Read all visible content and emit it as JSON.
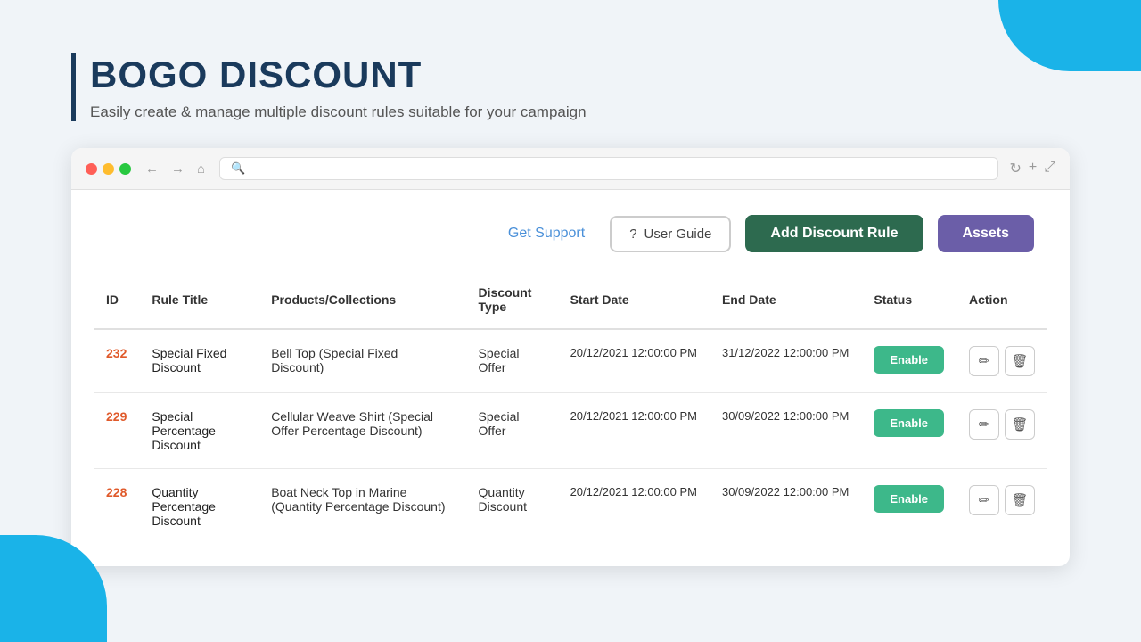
{
  "page": {
    "title": "BOGO DISCOUNT",
    "subtitle": "Easily create & manage multiple discount rules suitable for your campaign"
  },
  "toolbar": {
    "get_support_label": "Get Support",
    "user_guide_label": "User Guide",
    "add_discount_label": "Add Discount Rule",
    "assets_label": "Assets"
  },
  "table": {
    "headers": [
      "ID",
      "Rule Title",
      "Products/Collections",
      "Discount Type",
      "Start Date",
      "End Date",
      "Status",
      "Action"
    ],
    "rows": [
      {
        "id": "232",
        "rule_title": "Special Fixed Discount",
        "products": "Bell Top (Special Fixed Discount)",
        "discount_type": "Special Offer",
        "start_date": "20/12/2021 12:00:00 PM",
        "end_date": "31/12/2022 12:00:00 PM",
        "status": "Enable"
      },
      {
        "id": "229",
        "rule_title": "Special Percentage Discount",
        "products": "Cellular Weave Shirt (Special Offer Percentage Discount)",
        "discount_type": "Special Offer",
        "start_date": "20/12/2021 12:00:00 PM",
        "end_date": "30/09/2022 12:00:00 PM",
        "status": "Enable"
      },
      {
        "id": "228",
        "rule_title": "Quantity Percentage Discount",
        "products": "Boat Neck Top in Marine (Quantity Percentage Discount)",
        "discount_type": "Quantity Discount",
        "start_date": "20/12/2021 12:00:00 PM",
        "end_date": "30/09/2022 12:00:00 PM",
        "status": "Enable"
      }
    ]
  },
  "icons": {
    "question": "?",
    "back": "←",
    "forward": "→",
    "home": "⌂",
    "refresh": "↻",
    "new_tab": "+",
    "expand": "⤢",
    "edit": "✏",
    "delete": "🗑"
  },
  "colors": {
    "accent_blue": "#1ab3e8",
    "dark_navy": "#1a3a5c",
    "green_enable": "#3db88a",
    "orange_id": "#e05a2b",
    "purple_assets": "#6b5ea8",
    "dark_green_add": "#2d6a4f"
  }
}
